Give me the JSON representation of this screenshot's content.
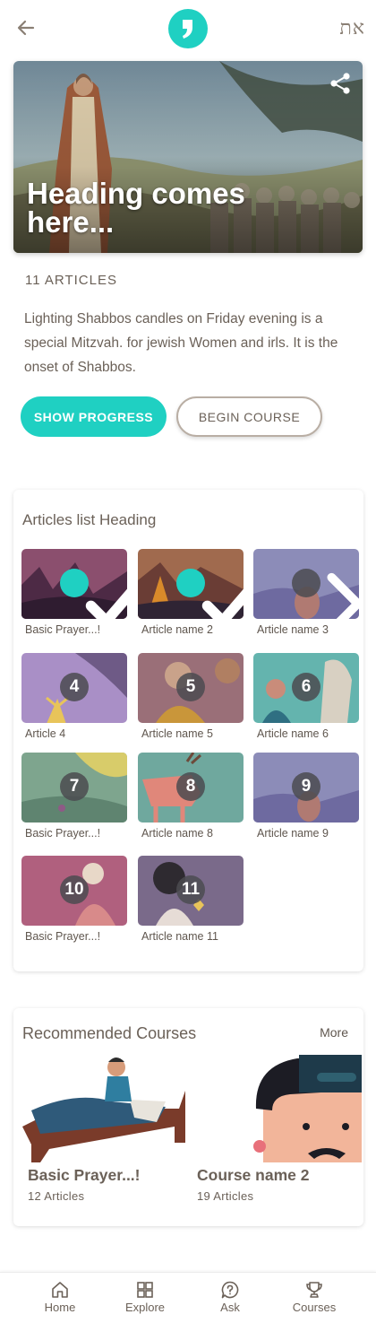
{
  "header": {
    "back_icon": "arrow-left-icon",
    "logo_icon": "apostrophe-logo-icon",
    "lang_label": "את",
    "accent_color": "#1fd0c2"
  },
  "hero": {
    "title": "Heading comes here...",
    "share_icon": "share-icon"
  },
  "course": {
    "article_count": "11 ARTICLES",
    "description": "Lighting Shabbos candles on Friday evening is a special Mitzvah. for jewish Women and irls. It is the onset of Shabbos.",
    "show_progress_label": "SHOW PROGRESS",
    "begin_course_label": "BEGIN COURSE"
  },
  "articles": {
    "heading": "Articles list Heading",
    "items": [
      {
        "label": "Basic Prayer...!",
        "status": "done",
        "badge": ""
      },
      {
        "label": "Article name 2",
        "status": "done",
        "badge": ""
      },
      {
        "label": "Article name 3",
        "status": "next",
        "badge": ""
      },
      {
        "label": "Article 4",
        "status": "locked",
        "badge": "4"
      },
      {
        "label": "Article name 5",
        "status": "locked",
        "badge": "5"
      },
      {
        "label": "Article name 6",
        "status": "locked",
        "badge": "6"
      },
      {
        "label": "Basic Prayer...!",
        "status": "locked",
        "badge": "7"
      },
      {
        "label": "Article name 8",
        "status": "locked",
        "badge": "8"
      },
      {
        "label": "Article name 9",
        "status": "locked",
        "badge": "9"
      },
      {
        "label": "Basic Prayer...!",
        "status": "locked",
        "badge": "10"
      },
      {
        "label": "Article name 11",
        "status": "locked",
        "badge": "11"
      }
    ]
  },
  "recommended": {
    "heading": "Recommended Courses",
    "more_label": "More",
    "courses": [
      {
        "name": "Basic Prayer...!",
        "count": "12 Articles"
      },
      {
        "name": "Course name 2",
        "count": "19 Articles"
      }
    ]
  },
  "nav": {
    "items": [
      {
        "label": "Home",
        "icon": "home-icon"
      },
      {
        "label": "Explore",
        "icon": "grid-icon"
      },
      {
        "label": "Ask",
        "icon": "question-bubble-icon"
      },
      {
        "label": "Courses",
        "icon": "trophy-icon"
      }
    ]
  }
}
